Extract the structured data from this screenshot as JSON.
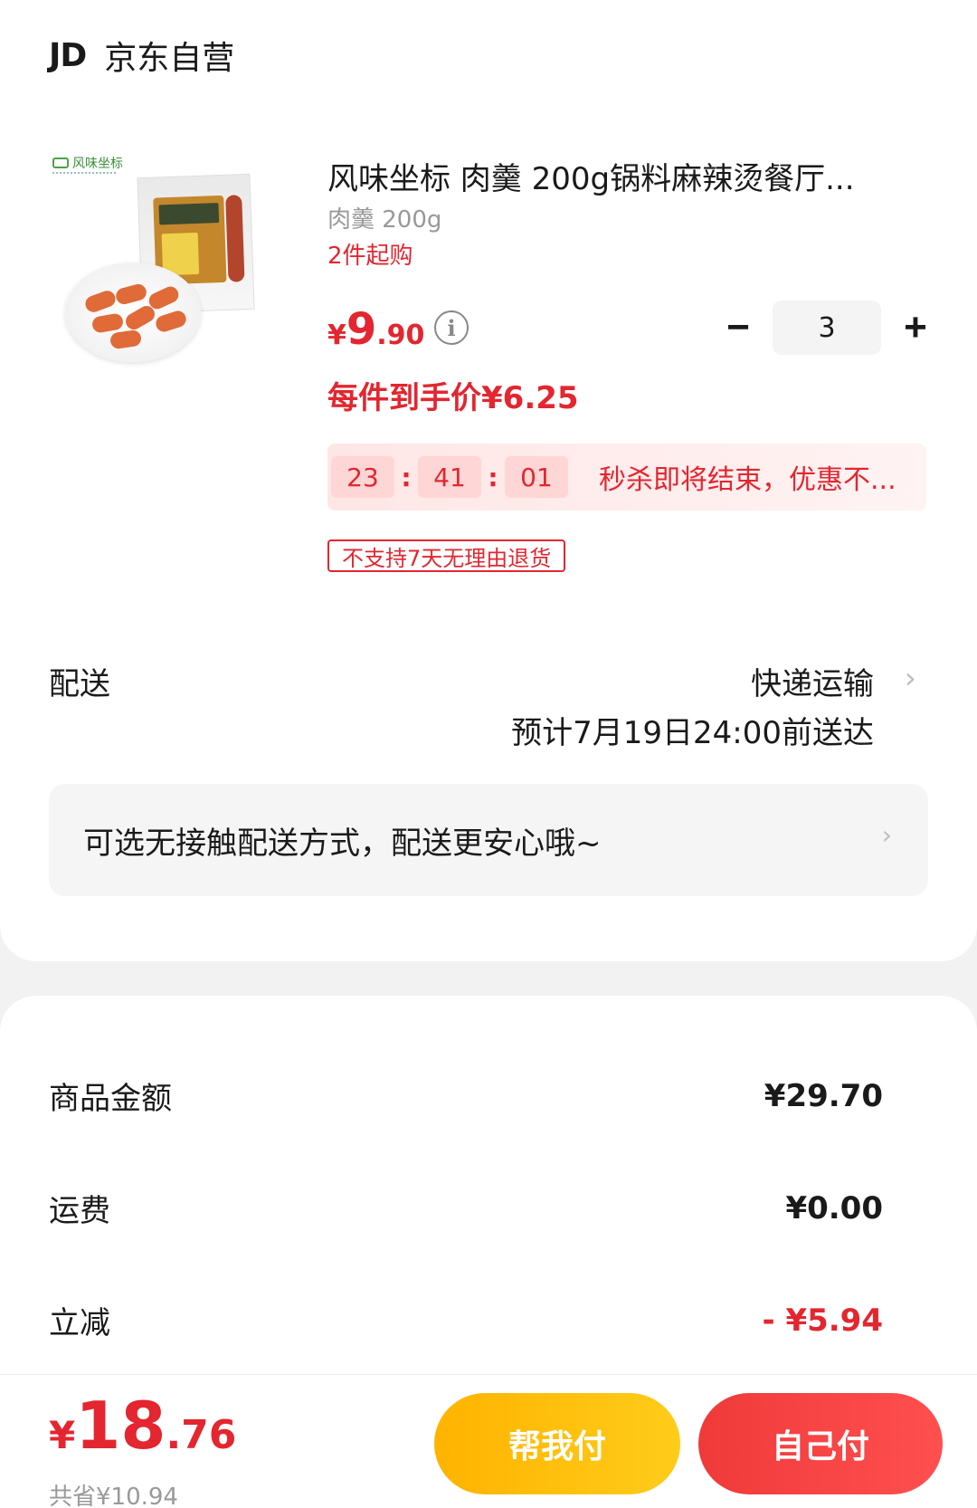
{
  "shop": {
    "logo_text": "JD",
    "name": "京东自营"
  },
  "product": {
    "brand_text": "风味坐标",
    "title": "风味坐标 肉羹 200g锅料麻辣烫餐厅...",
    "spec": "肉羹 200g",
    "min_purchase": "2件起购",
    "price": {
      "currency": "¥",
      "integer": "9",
      "decimal": ".90"
    },
    "info_icon": "info-circle-icon",
    "quantity": "3",
    "minus_glyph": "−",
    "plus_glyph": "+",
    "per_item_price": "每件到手价¥6.25",
    "countdown": {
      "hours": "23",
      "minutes": "41",
      "seconds": "01",
      "separator": ":"
    },
    "flash_text": "秒杀即将结束，优惠不...",
    "return_policy": "不支持7天无理由退货"
  },
  "delivery": {
    "label": "配送",
    "method": "快递运输",
    "eta": "预计7月19日24:00前送达",
    "contactless_text": "可选无接触配送方式，配送更安心哦~"
  },
  "amounts": {
    "goods_label": "商品金额",
    "goods_value": "¥29.70",
    "shipping_label": "运费",
    "shipping_value": "¥0.00",
    "discount_label": "立减",
    "discount_value": "- ¥5.94"
  },
  "footer": {
    "total": {
      "currency": "¥",
      "integer": "18",
      "decimal": ".76"
    },
    "saved": "共省¥10.94",
    "help_pay_label": "帮我付",
    "self_pay_label": "自己付"
  },
  "colors": {
    "accent_red": "#e3262f",
    "help_yellow": "#ffbd0d",
    "pay_red": "#f53d3d"
  }
}
